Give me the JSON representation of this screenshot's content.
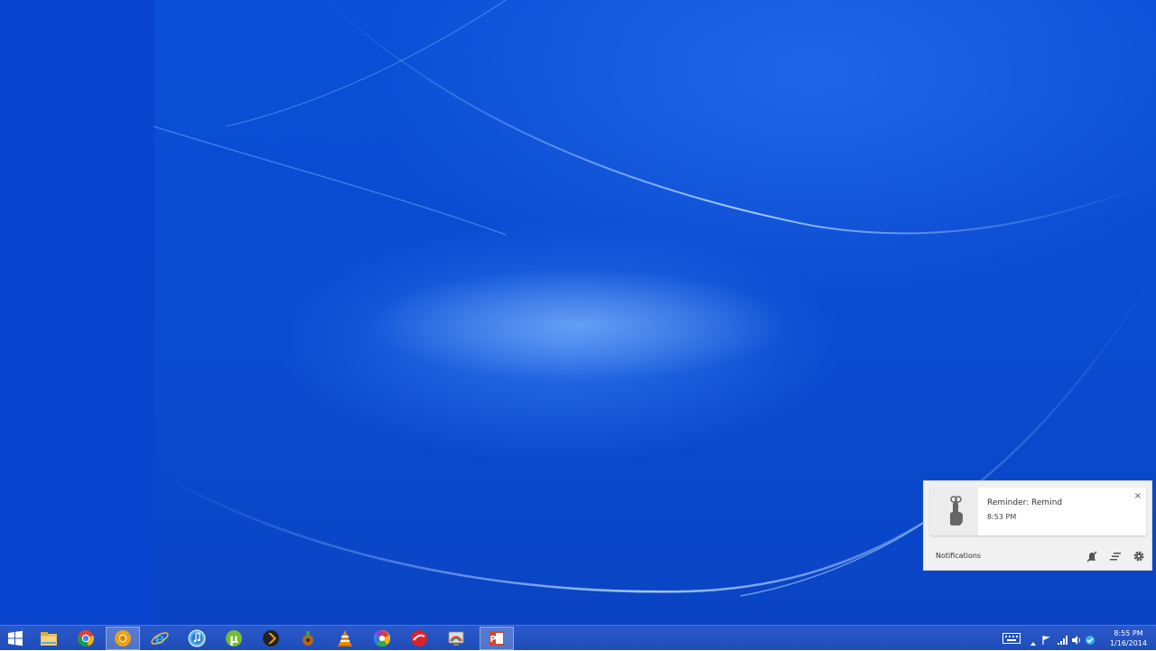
{
  "notification": {
    "title": "Reminder: Remind",
    "time": "8:53 PM",
    "close_glyph": "×",
    "icon": "finger-string-reminder-icon"
  },
  "notification_center": {
    "label": "Notifications",
    "tools": [
      "do-not-disturb-icon",
      "clear-all-icon",
      "settings-gear-icon"
    ]
  },
  "taskbar": {
    "pinned": [
      {
        "name": "file-explorer-icon"
      },
      {
        "name": "chrome-icon"
      },
      {
        "name": "chrome-canary-icon",
        "active": true
      },
      {
        "name": "internet-explorer-icon"
      },
      {
        "name": "itunes-icon"
      },
      {
        "name": "utorrent-icon"
      },
      {
        "name": "plex-icon"
      },
      {
        "name": "keepass-icon"
      },
      {
        "name": "vlc-icon"
      },
      {
        "name": "picasa-icon"
      },
      {
        "name": "security-app-icon"
      },
      {
        "name": "remote-desktop-icon"
      },
      {
        "name": "powerpoint-icon",
        "active": true
      }
    ]
  },
  "clock": {
    "time": "8:55 PM",
    "date": "1/16/2014"
  },
  "colors": {
    "desktop": "#0a4fd6",
    "taskbar": "#2356c4"
  }
}
